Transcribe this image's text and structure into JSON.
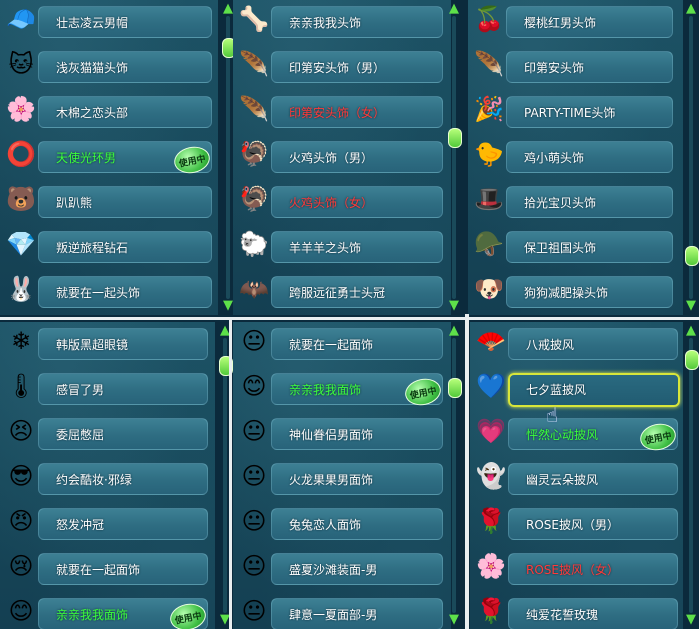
{
  "badge_text": "使用中",
  "panels": [
    {
      "items": [
        {
          "label": "壮志凌云男帽",
          "icon": "🧢",
          "color": "white"
        },
        {
          "label": "浅灰猫猫头饰",
          "icon": "🐱",
          "color": "white"
        },
        {
          "label": "木棉之恋头部",
          "icon": "🌸",
          "color": "white"
        },
        {
          "label": "天使光环男",
          "icon": "⭕",
          "color": "green",
          "badge": true
        },
        {
          "label": "趴趴熊",
          "icon": "🐻",
          "color": "white"
        },
        {
          "label": "叛逆旅程钻石",
          "icon": "💎",
          "color": "white"
        },
        {
          "label": "就要在一起头饰",
          "icon": "🐰",
          "color": "white"
        }
      ]
    },
    {
      "items": [
        {
          "label": "亲亲我我头饰",
          "icon": "🦴",
          "color": "white"
        },
        {
          "label": "印第安头饰（男）",
          "icon": "🪶",
          "color": "white"
        },
        {
          "label": "印第安头饰（女）",
          "icon": "🪶",
          "color": "red"
        },
        {
          "label": "火鸡头饰（男）",
          "icon": "🦃",
          "color": "white"
        },
        {
          "label": "火鸡头饰（女）",
          "icon": "🦃",
          "color": "red"
        },
        {
          "label": "羊羊羊之头饰",
          "icon": "🐑",
          "color": "white"
        },
        {
          "label": "跨服远征勇士头冠",
          "icon": "🦇",
          "color": "white"
        }
      ]
    },
    {
      "items": [
        {
          "label": "樱桃红男头饰",
          "icon": "🍒",
          "color": "white"
        },
        {
          "label": "印第安头饰",
          "icon": "🪶",
          "color": "white"
        },
        {
          "label": "PARTY-TIME头饰",
          "icon": "🎉",
          "color": "white"
        },
        {
          "label": "鸡小萌头饰",
          "icon": "🐤",
          "color": "white"
        },
        {
          "label": "拾光宝贝头饰",
          "icon": "🎩",
          "color": "white"
        },
        {
          "label": "保卫祖国头饰",
          "icon": "🪖",
          "color": "white"
        },
        {
          "label": "狗狗减肥操头饰",
          "icon": "🐶",
          "color": "white"
        }
      ]
    },
    {
      "items": [
        {
          "label": "韩版黑超眼镜",
          "icon": "❄",
          "color": "white"
        },
        {
          "label": "感冒了男",
          "icon": "🌡",
          "color": "white"
        },
        {
          "label": "委屈憋屈",
          "icon": "😣",
          "color": "white"
        },
        {
          "label": "约会酷妆·邪绿",
          "icon": "😎",
          "color": "white"
        },
        {
          "label": "怒发冲冠",
          "icon": "😠",
          "color": "white"
        },
        {
          "label": "就要在一起面饰",
          "icon": "😢",
          "color": "white"
        },
        {
          "label": "亲亲我我面饰",
          "icon": "😊",
          "color": "green",
          "badge": true
        }
      ]
    },
    {
      "items": [
        {
          "label": "就要在一起面饰",
          "icon": "😐",
          "color": "white"
        },
        {
          "label": "亲亲我我面饰",
          "icon": "😊",
          "color": "green",
          "badge": true
        },
        {
          "label": "神仙眷侣男面饰",
          "icon": "😐",
          "color": "white"
        },
        {
          "label": "火龙果果男面饰",
          "icon": "😐",
          "color": "white"
        },
        {
          "label": "兔兔恋人面饰",
          "icon": "😐",
          "color": "white"
        },
        {
          "label": "盛夏沙滩装面-男",
          "icon": "😐",
          "color": "white"
        },
        {
          "label": "肆意一夏面部-男",
          "icon": "😐",
          "color": "white"
        }
      ]
    },
    {
      "items": [
        {
          "label": "八戒披风",
          "icon": "🪭",
          "color": "white"
        },
        {
          "label": "七夕蓝披风",
          "icon": "💙",
          "color": "white",
          "selected": true
        },
        {
          "label": "怦然心动披风",
          "icon": "💗",
          "color": "green",
          "badge": true
        },
        {
          "label": "幽灵云朵披风",
          "icon": "👻",
          "color": "white"
        },
        {
          "label": "ROSE披风（男）",
          "icon": "🌹",
          "color": "white"
        },
        {
          "label": "ROSE披风（女）",
          "icon": "🌸",
          "color": "red"
        },
        {
          "label": "纯爱花誓玫瑰",
          "icon": "🌹",
          "color": "white"
        }
      ]
    }
  ]
}
